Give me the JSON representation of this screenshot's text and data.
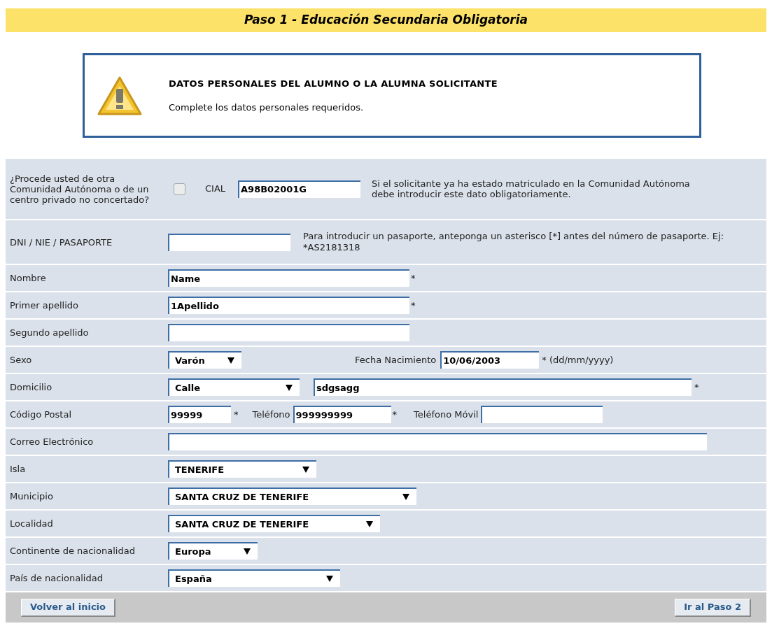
{
  "header": {
    "title": "Paso 1 - Educación Secundaria Obligatoria"
  },
  "notice": {
    "title": "DATOS PERSONALES DEL ALUMNO O LA ALUMNA SOLICITANTE",
    "text": "Complete los datos personales requeridos."
  },
  "rows": [
    {
      "label": "¿Procede usted de otra Comunidad Autónoma o de un centro privado no concertado?",
      "controls": [
        {
          "kind": "checkbox",
          "checked": false
        },
        {
          "kind": "text",
          "text": "CIAL"
        },
        {
          "kind": "input",
          "value": "A98B02001G"
        },
        {
          "kind": "hint",
          "text": "Si el solicitante ya ha estado matriculado en la Comunidad Autónoma debe introducir este dato obligatoriamente."
        }
      ]
    },
    {
      "label": "DNI / NIE / PASAPORTE",
      "controls": [
        {
          "kind": "input"
        },
        {
          "kind": "hint",
          "text": "Para introducir un pasaporte, anteponga un asterisco [*] antes del número de pasaporte. Ej: *AS2181318"
        }
      ]
    },
    {
      "label": "Nombre",
      "controls": [
        {
          "kind": "input",
          "value": "Name"
        },
        {
          "kind": "text",
          "text": "*"
        }
      ]
    },
    {
      "label": "Primer apellido",
      "controls": [
        {
          "kind": "input",
          "value": "1Apellido"
        },
        {
          "kind": "text",
          "text": "*"
        }
      ]
    },
    {
      "label": "Segundo apellido",
      "controls": [
        {
          "kind": "input"
        }
      ]
    },
    {
      "label": "Sexo",
      "controls": [
        {
          "kind": "select",
          "value": "Varón"
        },
        {
          "kind": "text",
          "text": "Fecha Nacimiento"
        },
        {
          "kind": "input",
          "value": "10/06/2003"
        },
        {
          "kind": "text",
          "text": "* (dd/mm/yyyy)"
        }
      ]
    },
    {
      "label": "Domicilio",
      "controls": [
        {
          "kind": "select",
          "value": "Calle"
        },
        {
          "kind": "input",
          "value": "sdgsagg"
        },
        {
          "kind": "text",
          "text": "*"
        }
      ]
    },
    {
      "label": "Código Postal",
      "controls": [
        {
          "kind": "input",
          "value": "99999"
        },
        {
          "kind": "text",
          "text": "*"
        },
        {
          "kind": "text",
          "text": "Teléfono"
        },
        {
          "kind": "input",
          "value": "999999999"
        },
        {
          "kind": "text",
          "text": "*"
        },
        {
          "kind": "text",
          "text": "Teléfono Móvil"
        },
        {
          "kind": "input"
        }
      ]
    },
    {
      "label": "Correo Electrónico",
      "controls": [
        {
          "kind": "input"
        }
      ]
    },
    {
      "label": "Isla",
      "controls": [
        {
          "kind": "select",
          "value": "TENERIFE"
        }
      ]
    },
    {
      "label": "Municipio",
      "controls": [
        {
          "kind": "select",
          "value": "SANTA CRUZ DE TENERIFE"
        }
      ]
    },
    {
      "label": "Localidad",
      "controls": [
        {
          "kind": "select",
          "value": "SANTA CRUZ DE TENERIFE"
        }
      ]
    },
    {
      "label": "Continente de nacionalidad",
      "controls": [
        {
          "kind": "select",
          "value": "Europa"
        }
      ]
    },
    {
      "label": "País de nacionalidad",
      "controls": [
        {
          "kind": "select",
          "value": "España"
        }
      ]
    }
  ],
  "footer": {
    "buttons": [
      "Volver al inicio",
      "Ir al Paso 2"
    ]
  }
}
